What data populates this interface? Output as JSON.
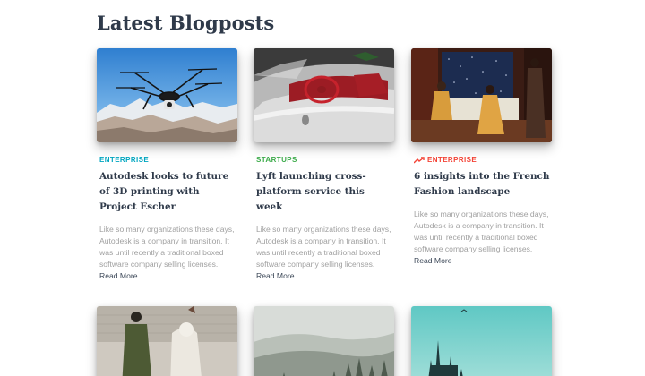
{
  "section_title": "Latest Blogposts",
  "colors": {
    "enterprise_cyan": "#00a6c0",
    "startups_green": "#3cab4a",
    "enterprise_red": "#f44336",
    "title_dark": "#2f3a4a",
    "description_gray": "#a0a0a0"
  },
  "posts": [
    {
      "image": "drone-over-snowy-mountains",
      "category": "ENTERPRISE",
      "category_icon": "",
      "title": "Autodesk looks to future of 3D printing with Project Escher",
      "description": "Like so many organizations these days, Autodesk is a company in transition. It was until recently a traditional boxed software company selling licenses.",
      "read_more": "Read More"
    },
    {
      "image": "vintage-convertible-car-interior",
      "category": "STARTUPS",
      "category_icon": "",
      "title": "Lyft launching cross-platform service this week",
      "description": "Like so many organizations these days, Autodesk is a company in transition. It was until recently a traditional boxed software company selling licenses.",
      "read_more": "Read More"
    },
    {
      "image": "fashion-models-in-dark-room",
      "category": "ENTERPRISE",
      "category_icon": "trending-up-icon",
      "title": "6 insights into the French Fashion landscape",
      "description": "Like so many organizations these days, Autodesk is a company in transition. It was until recently a traditional boxed software company selling licenses.",
      "read_more": "Read More"
    }
  ],
  "second_row_images": [
    "sculptor-working-on-statue",
    "misty-forest-hills",
    "castle-under-teal-sky"
  ]
}
